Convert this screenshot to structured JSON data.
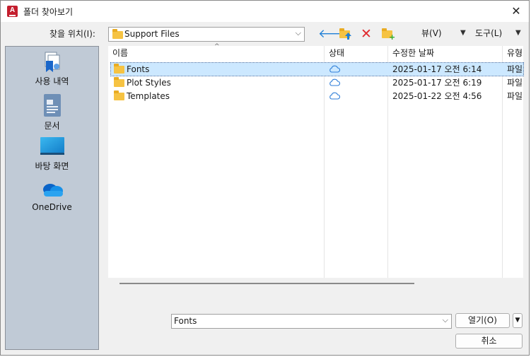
{
  "window": {
    "title": "폴더 찾아보기",
    "app_icon_letter": "A"
  },
  "toolbar": {
    "look_in_label": "찾을 위치(I):",
    "look_in_value": "Support Files",
    "view_label": "뷰(V)",
    "tools_label": "도구(L)"
  },
  "places": [
    {
      "label": "사용 내역",
      "icon": "history-icon"
    },
    {
      "label": "문서",
      "icon": "documents-icon"
    },
    {
      "label": "바탕 화면",
      "icon": "desktop-icon"
    },
    {
      "label": "OneDrive",
      "icon": "onedrive-icon"
    }
  ],
  "columns": {
    "name": "이름",
    "status": "상태",
    "modified": "수정한 날짜",
    "type": "유형"
  },
  "files": [
    {
      "name": "Fonts",
      "modified": "2025-01-17 오전 6:14",
      "type": "파일",
      "status_icon": "cloud-icon",
      "selected": true
    },
    {
      "name": "Plot Styles",
      "modified": "2025-01-17 오전 6:19",
      "type": "파일",
      "status_icon": "cloud-icon",
      "selected": false
    },
    {
      "name": "Templates",
      "modified": "2025-01-22 오전 4:56",
      "type": "파일",
      "status_icon": "cloud-icon",
      "selected": false
    }
  ],
  "footer": {
    "folder_name_value": "Fonts",
    "open_label": "열기(O)",
    "cancel_label": "취소"
  },
  "colors": {
    "accent": "#1f7fd6",
    "selection": "#cce8ff",
    "places_bg": "#c0cad6",
    "delete": "#e0292e",
    "folder": "#f6c343"
  }
}
